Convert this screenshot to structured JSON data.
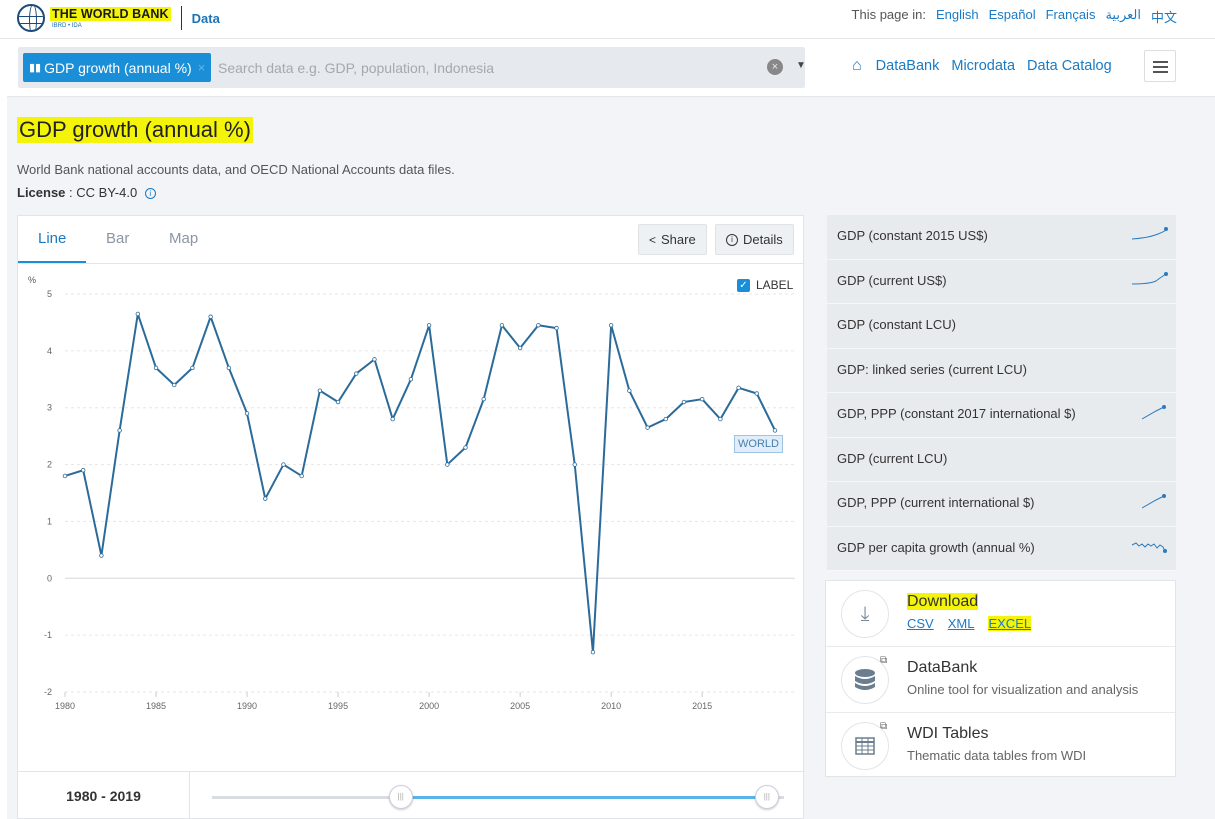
{
  "header": {
    "logo_text": "THE WORLD BANK",
    "logo_sub": "IBRD • IDA",
    "section": "Data",
    "lang_label": "This page in:",
    "languages": [
      "English",
      "Español",
      "Français",
      "العربية",
      "中文"
    ]
  },
  "search": {
    "chip_label": "GDP growth (annual %)",
    "chip_close": "×",
    "placeholder": "Search data e.g. GDP, population, Indonesia",
    "clear": "×",
    "dropdown": "▼"
  },
  "nav": {
    "databank": "DataBank",
    "microdata": "Microdata",
    "catalog": "Data Catalog"
  },
  "page": {
    "title": "GDP growth (annual %)",
    "description": "World Bank national accounts data, and OECD National Accounts data files.",
    "license_label": "License",
    "license_value": " : CC BY-4.0 "
  },
  "chart_tabs": {
    "line": "Line",
    "bar": "Bar",
    "map": "Map",
    "share": "Share",
    "details": "Details",
    "label_toggle": "LABEL",
    "label_checked": true
  },
  "chart_data": {
    "type": "line",
    "ylabel": "%",
    "ylim": [
      -2,
      5
    ],
    "yticks": [
      5,
      4,
      3,
      2,
      1,
      0,
      -1,
      -2
    ],
    "xticks": [
      1980,
      1985,
      1990,
      1995,
      2000,
      2005,
      2010,
      2015
    ],
    "series": [
      {
        "name": "WORLD",
        "color": "#2b6b9a",
        "x": [
          1980,
          1981,
          1982,
          1983,
          1984,
          1985,
          1986,
          1987,
          1988,
          1989,
          1990,
          1991,
          1992,
          1993,
          1994,
          1995,
          1996,
          1997,
          1998,
          1999,
          2000,
          2001,
          2002,
          2003,
          2004,
          2005,
          2006,
          2007,
          2008,
          2009,
          2010,
          2011,
          2012,
          2013,
          2014,
          2015,
          2016,
          2017,
          2018,
          2019
        ],
        "values": [
          1.8,
          1.9,
          0.4,
          2.6,
          4.65,
          3.7,
          3.4,
          3.7,
          4.6,
          3.7,
          2.9,
          1.4,
          2.0,
          1.8,
          3.3,
          3.1,
          3.6,
          3.85,
          2.8,
          3.5,
          4.45,
          2.0,
          2.3,
          3.15,
          4.45,
          4.05,
          4.45,
          4.4,
          2.0,
          -1.3,
          4.45,
          3.3,
          2.65,
          2.8,
          3.1,
          3.15,
          2.8,
          3.35,
          3.25,
          2.6
        ]
      }
    ],
    "grid": true
  },
  "range": {
    "label": "1980 - 2019",
    "start_fraction": 0.33,
    "end_fraction": 0.97
  },
  "related": [
    {
      "label": "GDP (constant 2015 US$)",
      "spark": "up"
    },
    {
      "label": "GDP (current US$)",
      "spark": "up2"
    },
    {
      "label": "GDP (constant LCU)",
      "spark": ""
    },
    {
      "label": "GDP: linked series (current LCU)",
      "spark": ""
    },
    {
      "label": "GDP, PPP (constant 2017 international $)",
      "spark": "short"
    },
    {
      "label": "GDP (current LCU)",
      "spark": ""
    },
    {
      "label": "GDP, PPP (current international $)",
      "spark": "short"
    },
    {
      "label": "GDP per capita growth (annual %)",
      "spark": "wave"
    }
  ],
  "downloads": {
    "download_title": "Download",
    "formats": [
      "CSV",
      "XML",
      "EXCEL"
    ],
    "databank_title": "DataBank",
    "databank_sub": "Online tool for visualization and analysis",
    "wdi_title": "WDI Tables",
    "wdi_sub": "Thematic data tables from WDI"
  }
}
